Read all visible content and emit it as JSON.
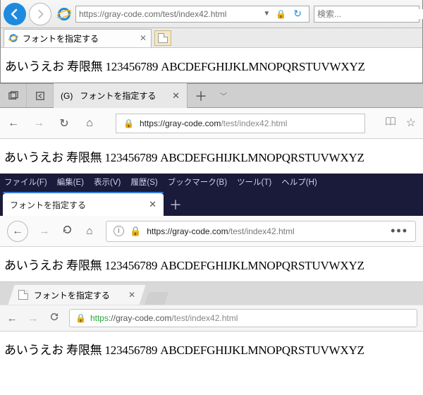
{
  "shared": {
    "tab_title": "フォントを指定する",
    "content_text": "あいうえお 寿限無 123456789 ABCDEFGHIJKLMNOPQRSTUVWXYZ"
  },
  "ie": {
    "url": "https://gray-code.com/test/index42.html",
    "search_placeholder": "検索..."
  },
  "edge": {
    "tab_prefix": "(G)",
    "tab_label": "フォントを指定する",
    "host": "https://gray-code.com",
    "path": "/test/index42.html"
  },
  "firefox": {
    "menus": {
      "file": "ファイル(F)",
      "edit": "編集(E)",
      "view": "表示(V)",
      "history": "履歴(S)",
      "bookmarks": "ブックマーク(B)",
      "tools": "ツール(T)",
      "help": "ヘルプ(H)"
    },
    "host": "https://gray-code.com",
    "path": "/test/index42.html"
  },
  "chrome": {
    "scheme": "https",
    "sep": "://",
    "host": "gray-code.com",
    "path": "/test/index42.html"
  }
}
